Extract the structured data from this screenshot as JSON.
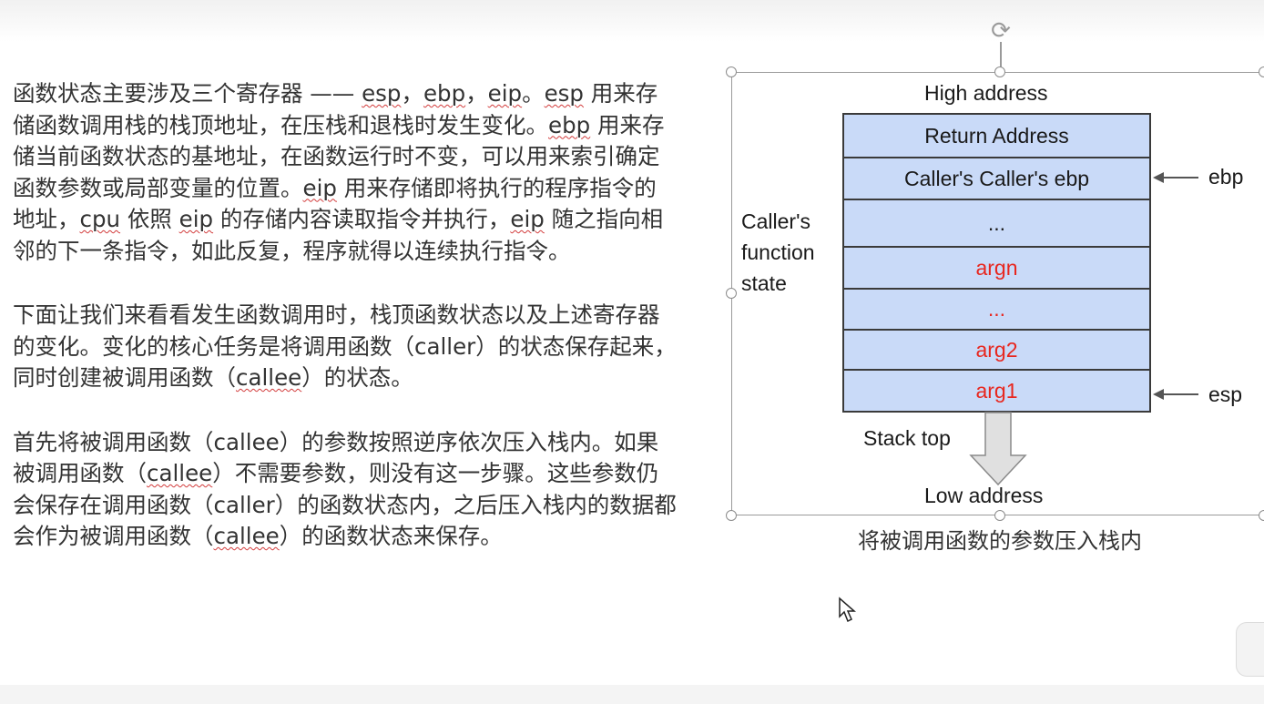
{
  "text": {
    "p1": [
      {
        "t": "函数状态主要涉及三个寄存器 —— "
      },
      {
        "t": "esp",
        "wavy": true
      },
      {
        "t": "，"
      },
      {
        "t": "ebp",
        "wavy": true
      },
      {
        "t": "，"
      },
      {
        "t": "eip",
        "wavy": true
      },
      {
        "t": "。"
      },
      {
        "t": "esp",
        "wavy": true
      },
      {
        "t": " 用来存储函数调用栈的栈顶地址，在压栈和退栈时发生变化。"
      },
      {
        "t": "ebp",
        "wavy": true
      },
      {
        "t": " 用来存储当前函数状态的基地址，在函数运行时不变，可以用来索引确定函数参数或局部变量的位置。"
      },
      {
        "t": "eip",
        "wavy": true
      },
      {
        "t": " 用来存储即将执行的程序指令的地址，"
      },
      {
        "t": "cpu",
        "wavy": true
      },
      {
        "t": " 依照 "
      },
      {
        "t": "eip",
        "wavy": true
      },
      {
        "t": " 的存储内容读取指令并执行，"
      },
      {
        "t": "eip",
        "wavy": true
      },
      {
        "t": " 随之指向相邻的下一条指令，如此反复，程序就得以连续执行指令。"
      }
    ],
    "p2": [
      {
        "t": "下面让我们来看看发生函数调用时，栈顶函数状态以及上述寄存器的变化。变化的核心任务是将调用函数（caller）的状态保存起来，同时创建被调用函数（"
      },
      {
        "t": "callee",
        "wavy": true
      },
      {
        "t": "）的状态。"
      }
    ],
    "p3": [
      {
        "t": "首先将被调用函数（callee）的参数按照逆序依次压入栈内。如果被调用函数（"
      },
      {
        "t": "callee",
        "wavy": true
      },
      {
        "t": "）不需要参数，则没有这一步骤。这些参数仍会保存在调用函数（caller）的函数状态内，之后压入栈内的数据都会作为被调用函数（"
      },
      {
        "t": "callee",
        "wavy": true
      },
      {
        "t": "）的函数状态来保存。"
      }
    ]
  },
  "diagram": {
    "high_address": "High address",
    "low_address": "Low address",
    "caller_label_line1": "Caller's",
    "caller_label_line2": "function",
    "caller_label_line3": "state",
    "stack_top": "Stack top",
    "ebp_label": "ebp",
    "esp_label": "esp",
    "cells": [
      {
        "label": "Return Address",
        "red": false
      },
      {
        "label": "Caller's Caller's ebp",
        "red": false
      },
      {
        "label": "...",
        "red": false
      },
      {
        "label": "argn",
        "red": true
      },
      {
        "label": "...",
        "red": true
      },
      {
        "label": "arg2",
        "red": true
      },
      {
        "label": "arg1",
        "red": true
      }
    ],
    "caption": "将被调用函数的参数压入栈内",
    "colors": {
      "cell_fill": "#c9daf8",
      "arg_text": "#e8261e"
    }
  }
}
